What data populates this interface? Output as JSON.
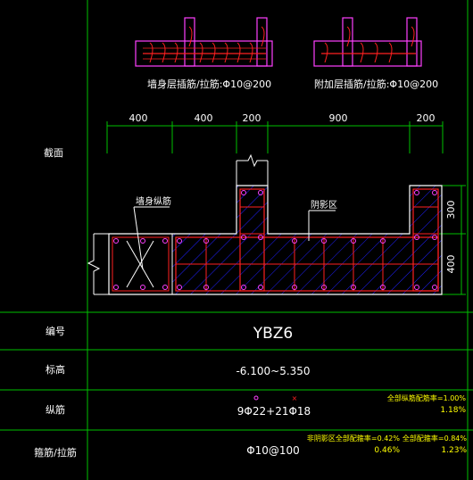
{
  "upper_left_caption": "墙身层插筋/拉筋:Φ10@200",
  "upper_right_caption": "附加层插筋/拉筋:Φ10@200",
  "dims_top": [
    "400",
    "400",
    "200",
    "900",
    "200"
  ],
  "dims_right": [
    "300",
    "400"
  ],
  "label_wall_bar": "墙身纵筋",
  "label_hatch": "阴影区",
  "table": {
    "section_label": "截面",
    "id_label": "编号",
    "id_value": "YBZ6",
    "elev_label": "标高",
    "elev_value": "-6.100~5.350",
    "rebar_label": "纵筋",
    "rebar_value": "9Φ22+21Φ18",
    "rebar_ratio_label": "全部纵筋配筋率=1.00%",
    "rebar_ratio_value": "1.18%",
    "stirrup_label": "箍筋/拉筋",
    "stirrup_value": "Φ10@100",
    "stirrup_note_left_label": "非阴影区全部配箍率=0.42%",
    "stirrup_note_left_value": "0.46%",
    "stirrup_note_right_label": "全部配箍率=0.84%",
    "stirrup_note_right_value": "1.23%"
  },
  "colors": {
    "background": "#000000",
    "grid": "#00c000",
    "text": "#ffffff",
    "rebar": "#ff2020",
    "outline": "#ff40ff",
    "hatch": "#2020ff",
    "note": "#ffff00"
  }
}
